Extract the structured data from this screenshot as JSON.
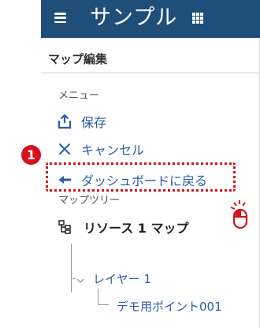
{
  "app": {
    "title": "サンプル",
    "menu_icon": "hamburger-icon",
    "apps_icon": "grid-apps-icon",
    "bar_color": "#1f4e79"
  },
  "panel": {
    "title": "マップ編集"
  },
  "menu": {
    "section_label": "メニュー",
    "items": [
      {
        "label": "保存",
        "icon": "share-upload-icon"
      },
      {
        "label": "キャンセル",
        "icon": "close-x-icon"
      },
      {
        "label": "ダッシュボードに戻る",
        "icon": "back-arrow-icon"
      }
    ]
  },
  "tree": {
    "section_label": "マップツリー",
    "root": {
      "label": "リソース 1 マップ",
      "icon": "hierarchy-icon"
    },
    "layer": {
      "label": "レイヤー 1",
      "icon": "chevron-down-icon"
    },
    "point": {
      "label": "デモ用ポイント001"
    }
  },
  "annotation": {
    "step_number": "1",
    "marker_color": "#d4131b",
    "click_icon": "mouse-click-icon"
  },
  "colors": {
    "accent": "#2a5ca8",
    "highlight": "#d4131b"
  }
}
